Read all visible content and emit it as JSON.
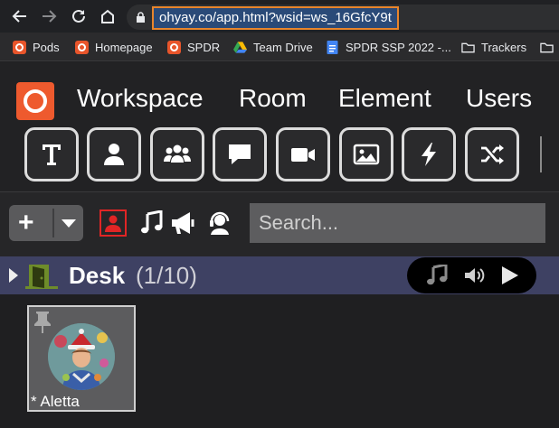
{
  "browser": {
    "url": "ohyay.co/app.html?wsid=ws_16GfcY9t",
    "bookmarks": [
      {
        "label": "Pods",
        "icon": "ohyay-icon"
      },
      {
        "label": "Homepage",
        "icon": "ohyay-icon"
      },
      {
        "label": "SPDR",
        "icon": "ohyay-icon"
      },
      {
        "label": "Team Drive",
        "icon": "google-drive-icon"
      },
      {
        "label": "SPDR SSP 2022 -...",
        "icon": "google-docs-icon"
      },
      {
        "label": "Trackers",
        "icon": "folder-icon"
      }
    ]
  },
  "app": {
    "menu": [
      "Workspace",
      "Room",
      "Element",
      "Users"
    ],
    "tools": [
      {
        "name": "text-tool",
        "icon": "text-icon"
      },
      {
        "name": "person-tool",
        "icon": "person-icon"
      },
      {
        "name": "group-tool",
        "icon": "group-icon"
      },
      {
        "name": "chat-tool",
        "icon": "speech-bubble-icon"
      },
      {
        "name": "video-tool",
        "icon": "video-camera-icon"
      },
      {
        "name": "image-tool",
        "icon": "image-icon"
      },
      {
        "name": "action-tool",
        "icon": "lightning-icon"
      },
      {
        "name": "shuffle-tool",
        "icon": "shuffle-icon"
      }
    ],
    "room_bar": {
      "add_label": "+",
      "search_placeholder": "Search..."
    },
    "room": {
      "name": "Desk",
      "count": "(1/10)"
    },
    "participant": {
      "label": "* Aletta"
    }
  },
  "colors": {
    "accent": "#ee5a2e",
    "url_highlight_border": "#e8852c",
    "room_row": "#3e4163",
    "active_mode": "#e02525"
  }
}
